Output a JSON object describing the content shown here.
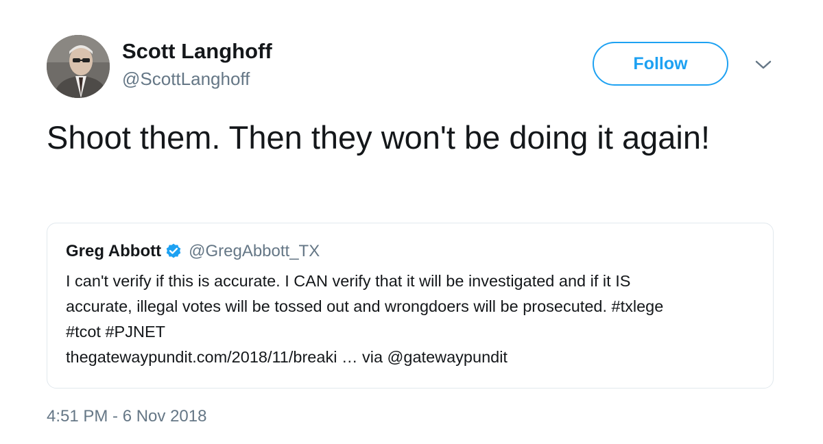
{
  "author": {
    "display_name": "Scott Langhoff",
    "handle": "@ScottLanghoff",
    "avatar_icon": "profile-photo"
  },
  "follow_button": {
    "label": "Follow",
    "color": "#1da1f2"
  },
  "menu": {
    "icon": "chevron-down-icon"
  },
  "tweet": {
    "text": "Shoot them. Then they won't be doing it again!"
  },
  "quoted_tweet": {
    "display_name": "Greg Abbott",
    "verified": true,
    "verified_icon": "verified-badge-icon",
    "handle": "@GregAbbott_TX",
    "lines": [
      "I can't verify if this is accurate. I CAN verify that it will be investigated and if it IS",
      "accurate, illegal votes will be tossed out and wrongdoers will be prosecuted. #txlege",
      "#tcot #PJNET",
      "thegatewaypundit.com/2018/11/breaki  … via @gatewaypundit"
    ]
  },
  "timestamp": "4:51 PM - 6 Nov 2018",
  "colors": {
    "text_primary": "#14171a",
    "text_secondary": "#657786",
    "accent": "#1da1f2",
    "border": "#e1e8ed"
  }
}
